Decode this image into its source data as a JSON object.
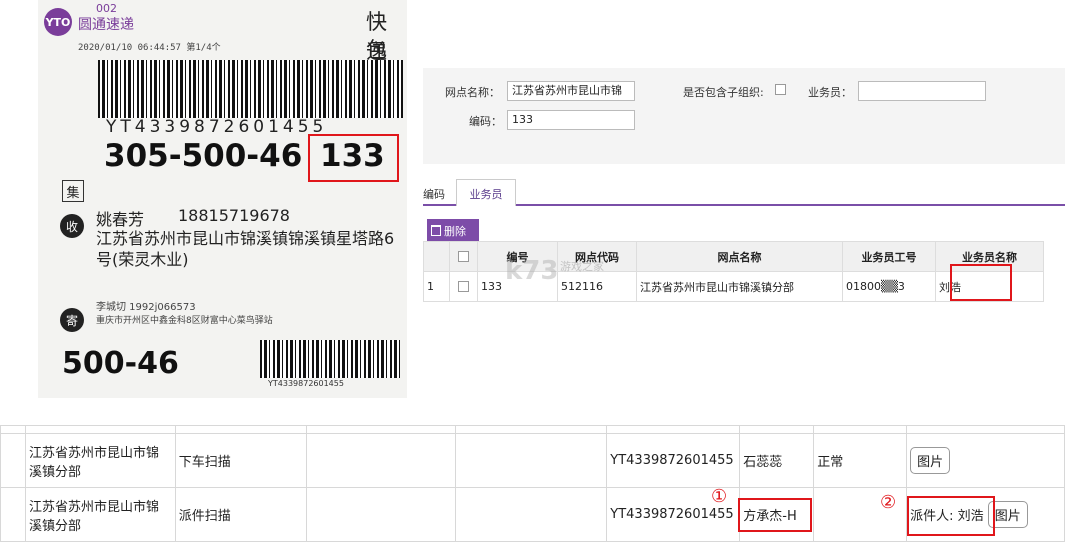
{
  "photo": {
    "code": "002",
    "brand": "圆通速递",
    "logo_text": "YTO",
    "timestamp": "2020/01/10   06:44:57   第1/4个",
    "header_line1": "快递",
    "header_line2": "包裹",
    "tracking_barcode_text": "YT4339872601455",
    "route_code": "305-500-46",
    "route_code_highlight": "133",
    "tag_ji": "集",
    "tag_shou": "收",
    "tag_ji2": "寄",
    "recipient_name": "姚春芳",
    "recipient_phone": "18815719678",
    "recipient_address": "江苏省苏州市昆山市锦溪镇锦溪镇星塔路6号(荣灵木业)",
    "sender_name": "李城切   1992j066573",
    "sender_address": "重庆市开州区中鑫金科8区财富中心菜鸟驿站",
    "short_code": "500-46",
    "small_barcode_text": "YT4339872601455"
  },
  "form": {
    "site_name_label": "网点名称：",
    "site_name_value": "江苏省苏州市昆山市锦",
    "include_sub_label": "是否包含子组织:",
    "salesman_label": "业务员：",
    "salesman_value": "",
    "code_label": "编码：",
    "code_value": "133"
  },
  "tabs": {
    "tab1": "编码",
    "tab2": "业务员"
  },
  "toolbar": {
    "delete_label": "删除"
  },
  "grid": {
    "headers": [
      "",
      "编号",
      "网点代码",
      "网点名称",
      "业务员工号",
      "业务员名称"
    ],
    "row": {
      "index": "1",
      "code": "133",
      "site_code": "512116",
      "site_name": "江苏省苏州市昆山市锦溪镇分部",
      "emp_no": "01800▒▒3",
      "emp_name": "刘浩"
    }
  },
  "watermark": {
    "logo": "k73",
    "text": "游戏之家",
    "url": ".com"
  },
  "records": [
    {
      "site": "江苏省苏州市昆山市锦溪镇分部",
      "action": "下车扫描",
      "tracking": "YT4339872601455",
      "operator": "石蕊蕊",
      "status": "正常",
      "note": "",
      "button": "图片"
    },
    {
      "site": "江苏省苏州市昆山市锦溪镇分部",
      "action": "派件扫描",
      "tracking": "YT4339872601455",
      "operator": "方承杰-H",
      "status": "",
      "note": "派件人: 刘浩",
      "button": "图片"
    }
  ],
  "annotations": {
    "marker1": "①",
    "marker2": "②"
  },
  "colors": {
    "highlight": "#e0161b",
    "accent": "#7d4ca8"
  }
}
